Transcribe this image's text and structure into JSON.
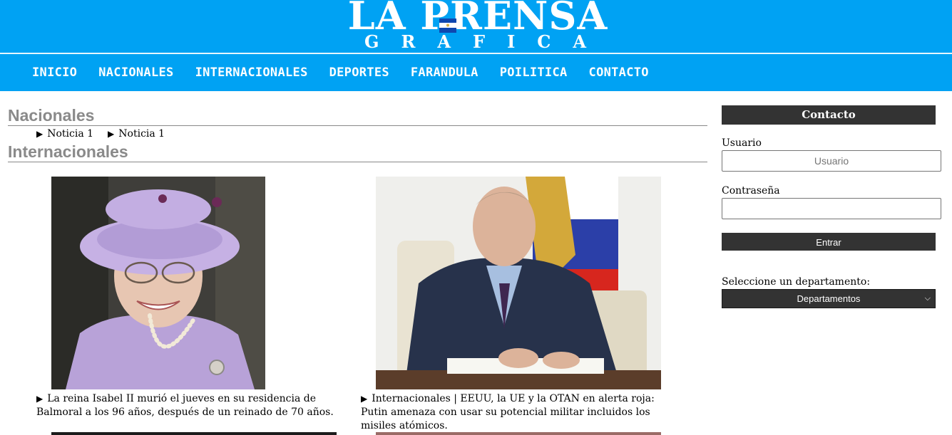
{
  "header": {
    "logo_main": "LA PRENSA",
    "logo_sub": "GRAFICA",
    "nav": [
      "INICIO",
      "NACIONALES",
      "INTERNACIONALES",
      "DEPORTES",
      "FARANDULA",
      "POILITICA",
      "CONTACTO"
    ]
  },
  "colors": {
    "header_bg": "#00a2f3",
    "dark": "#333333",
    "section_title": "#8a8a8a"
  },
  "main": {
    "sections": [
      {
        "title": "Nacionales",
        "items": [
          "Noticia 1",
          "Noticia 1"
        ]
      },
      {
        "title": "Internacionales"
      }
    ],
    "cards": [
      {
        "image": "photo of Queen Elizabeth II in lavender hat",
        "text": "La reina Isabel II murió el jueves en su residencia de Balmoral a los 96 años, después de un reinado de 70 años."
      },
      {
        "image": "photo of Vladimir Putin at a desk",
        "text": "Internacionales | EEUU, la UE y la OTAN en alerta roja: Putin amenaza con usar su potencial militar incluidos los misiles atómicos."
      }
    ]
  },
  "sidebar": {
    "title": "Contacto",
    "user_label": "Usuario",
    "user_placeholder": "Usuario",
    "pass_label": "Contraseña",
    "enter_label": "Entrar",
    "dept_label": "Seleccione un departamento:",
    "dept_selected": "Departamentos"
  }
}
